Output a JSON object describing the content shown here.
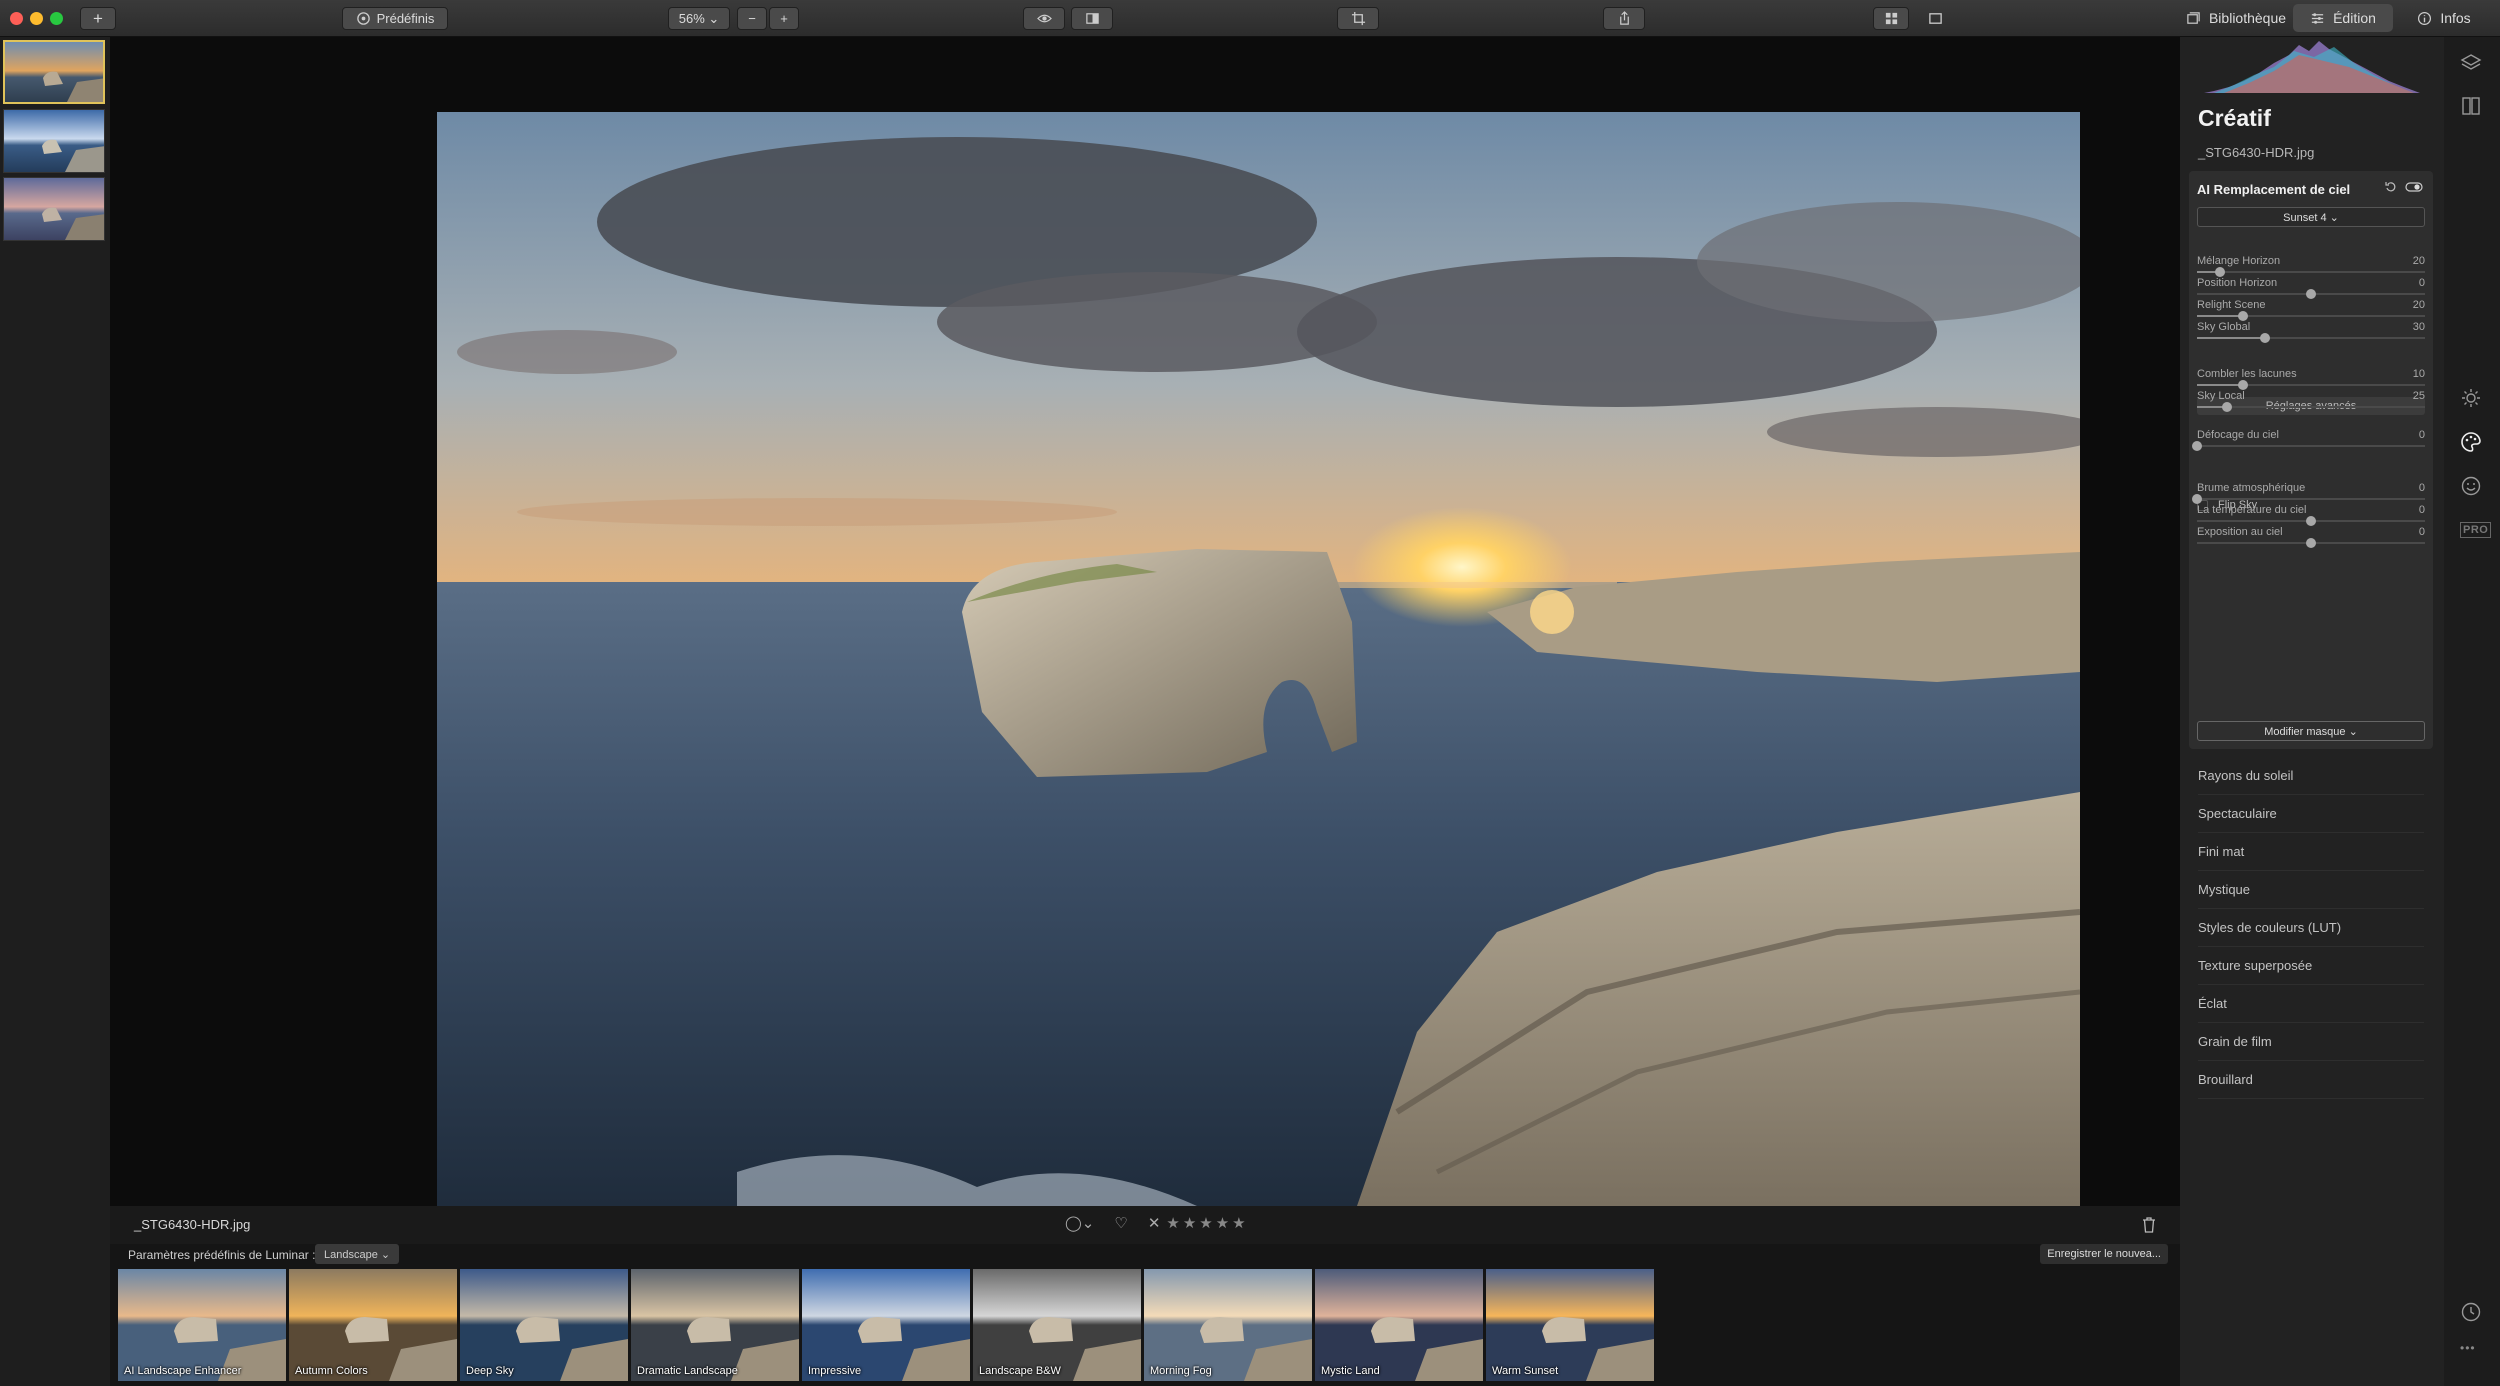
{
  "toolbar": {
    "add_label": "+",
    "presets_label": "Prédéfinis",
    "zoom_label": "56% ⌄",
    "zoom_out": "−",
    "zoom_in": "+",
    "library_label": "Bibliothèque",
    "edit_label": "Édition",
    "info_label": "Infos"
  },
  "image": {
    "filename": "_STG6430-HDR.jpg"
  },
  "rating": {
    "flag": "◯⌄",
    "heart": "♡",
    "reject": "✕",
    "stars": "★★★★★"
  },
  "presets": {
    "label": "Paramètres prédéfinis de Luminar :",
    "category": "Landscape ⌄",
    "save_label": "Enregistrer le nouvea...",
    "items": [
      {
        "name": "AI Landscape Enhancer"
      },
      {
        "name": "Autumn Colors"
      },
      {
        "name": "Deep Sky"
      },
      {
        "name": "Dramatic Landscape"
      },
      {
        "name": "Impressive"
      },
      {
        "name": "Landscape B&W"
      },
      {
        "name": "Morning Fog"
      },
      {
        "name": "Mystic Land"
      },
      {
        "name": "Warm Sunset"
      }
    ]
  },
  "panel": {
    "title": "Créatif",
    "file": "_STG6430-HDR.jpg",
    "card_title": "AI Remplacement de ciel",
    "sky_preset": "Sunset 4 ⌄",
    "advanced_label": "Réglages avancés",
    "flip_sky": "Flip Sky",
    "mask_label": "Modifier masque ⌄",
    "sliders": [
      {
        "label": "Mélange Horizon",
        "value": "20",
        "level": 0.1,
        "signed": false
      },
      {
        "label": "Position Horizon",
        "value": "0",
        "level": 0.0,
        "signed": true
      },
      {
        "label": "Relight Scene",
        "value": "20",
        "level": 0.2,
        "signed": false
      },
      {
        "label": "Sky Global",
        "value": "30",
        "level": 0.3,
        "signed": false
      },
      {
        "label": "Combler les lacunes",
        "value": "10",
        "level": 0.2,
        "signed": false
      },
      {
        "label": "Sky Local",
        "value": "25",
        "level": 0.13,
        "signed": false
      },
      {
        "label": "Défocage du ciel",
        "value": "0",
        "level": 0.0,
        "signed": false
      },
      {
        "label": "Brume atmosphérique",
        "value": "0",
        "level": 0.0,
        "signed": false
      },
      {
        "label": "La température du ciel",
        "value": "0",
        "level": 0.0,
        "signed": true
      },
      {
        "label": "Exposition au ciel",
        "value": "0",
        "level": 0.0,
        "signed": true
      }
    ],
    "tools": [
      {
        "label": "Rayons du soleil"
      },
      {
        "label": "Spectaculaire"
      },
      {
        "label": "Fini mat"
      },
      {
        "label": "Mystique"
      },
      {
        "label": "Styles de couleurs (LUT)"
      },
      {
        "label": "Texture superposée"
      },
      {
        "label": "Éclat"
      },
      {
        "label": "Grain de film"
      },
      {
        "label": "Brouillard"
      }
    ]
  },
  "rail": {
    "pro_badge": "PRO",
    "more": "•••"
  },
  "colors": {
    "accent": "#e0c35a",
    "panel_bg": "#222222",
    "card_bg": "#2e2e2e"
  }
}
